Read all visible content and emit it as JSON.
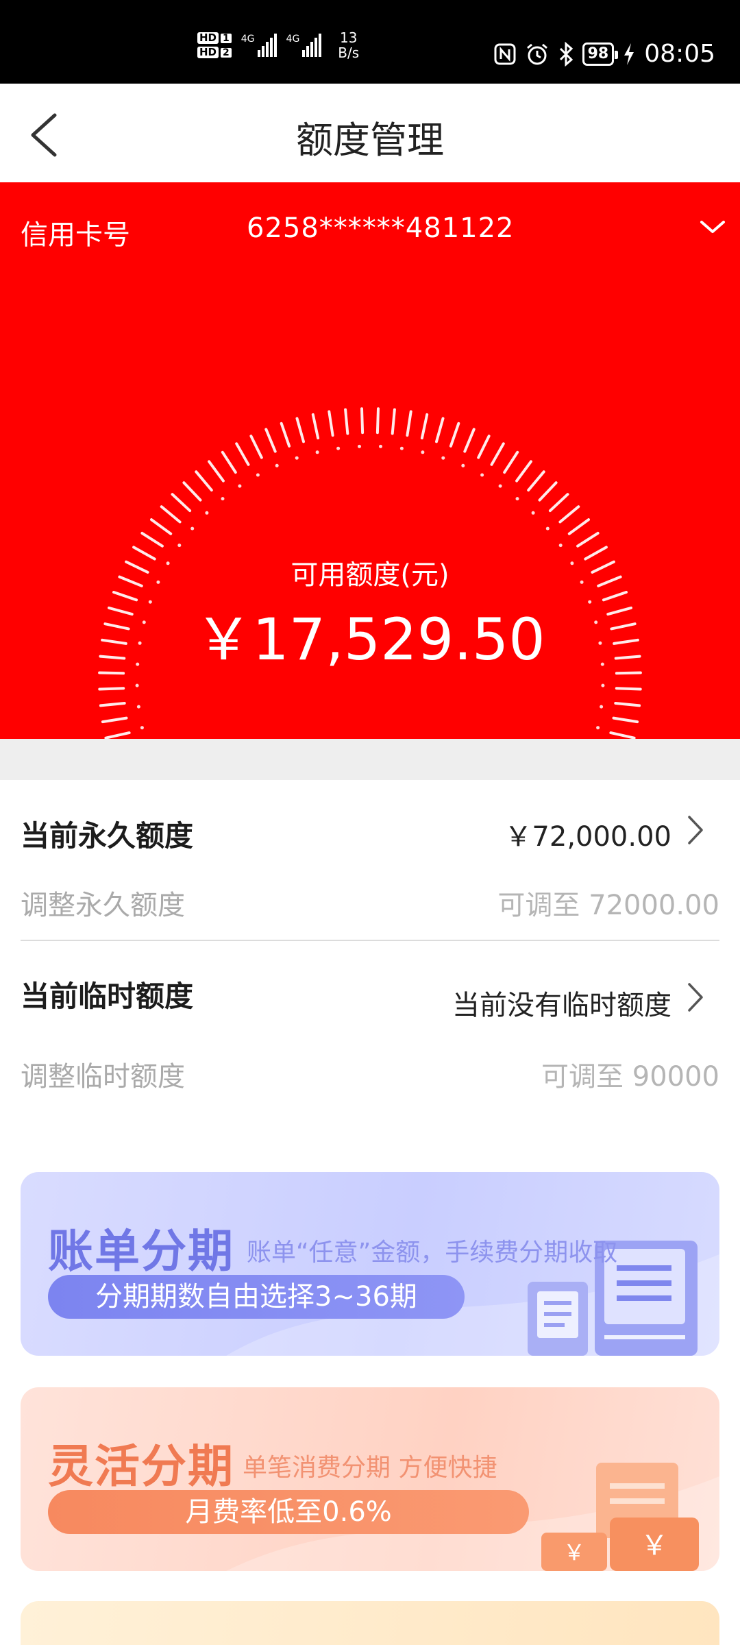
{
  "status_bar": {
    "hd1": "HD",
    "hd1_sim": "1",
    "hd2": "HD",
    "hd2_sim": "2",
    "net1": "4G",
    "net2": "4G",
    "speed_value": "13",
    "speed_unit": "B/s",
    "battery": "98",
    "time": "08:05",
    "icons": [
      "nfc-icon",
      "alarm-icon",
      "bluetooth-icon",
      "battery-icon",
      "charging-icon"
    ]
  },
  "nav": {
    "title": "额度管理",
    "back_icon": "chevron-left-icon"
  },
  "card": {
    "label": "信用卡号",
    "number": "6258******481122",
    "selector_icon": "chevron-down-icon"
  },
  "available": {
    "label": "可用额度(元)",
    "amount": "￥17,529.50"
  },
  "permanent": {
    "title": "当前永久额度",
    "value": "￥72,000.00",
    "adjust_label": "调整永久额度",
    "adjust_value": "可调至 72000.00"
  },
  "temporary": {
    "title": "当前临时额度",
    "value": "当前没有临时额度",
    "adjust_label": "调整临时额度",
    "adjust_value": "可调至 90000"
  },
  "banners": [
    {
      "title": "账单分期",
      "desc": "账单“任意”金额，手续费分期收取",
      "pill": "分期期数自由选择3~36期",
      "color": "#7077e6"
    },
    {
      "title": "灵活分期",
      "desc": "单笔消费分期 方便快捷",
      "pill": "月费率低至0.6%",
      "color": "#f07a52"
    }
  ],
  "colors": {
    "hero": "#ff0000",
    "banner1": "#c9ceff",
    "banner2": "#ffd2c3",
    "banner3": "#ffe5bf"
  }
}
